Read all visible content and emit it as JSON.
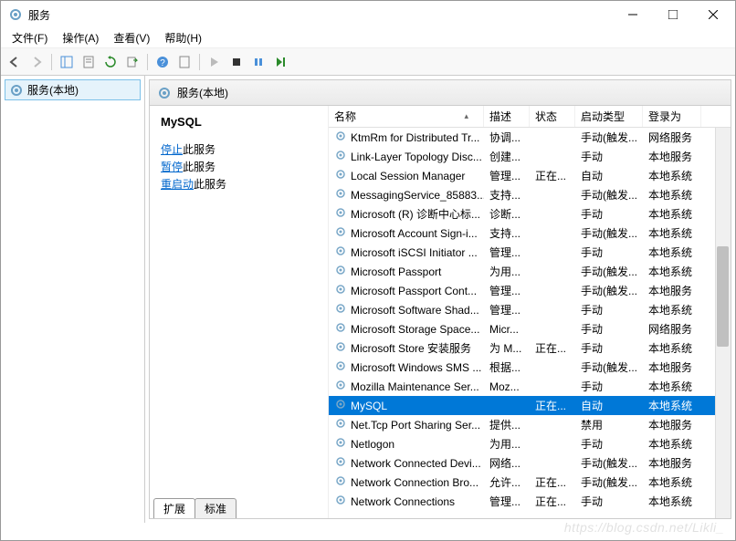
{
  "window": {
    "title": "服务",
    "tree_node": "服务(本地)",
    "right_header": "服务(本地)"
  },
  "menu": {
    "file": "文件(F)",
    "action": "操作(A)",
    "view": "查看(V)",
    "help": "帮助(H)"
  },
  "detail": {
    "service_name": "MySQL",
    "stop_link": "停止",
    "stop_suffix": "此服务",
    "pause_link": "暂停",
    "pause_suffix": "此服务",
    "restart_link": "重启动",
    "restart_suffix": "此服务"
  },
  "columns": {
    "name": "名称",
    "desc": "描述",
    "status": "状态",
    "startup": "启动类型",
    "logon": "登录为"
  },
  "tabs": {
    "extended": "扩展",
    "standard": "标准"
  },
  "watermark": "https://blog.csdn.net/Likli_",
  "services": [
    {
      "name": "KtmRm for Distributed Tr...",
      "desc": "协调...",
      "status": "",
      "startup": "手动(触发...",
      "logon": "网络服务",
      "selected": false
    },
    {
      "name": "Link-Layer Topology Disc...",
      "desc": "创建...",
      "status": "",
      "startup": "手动",
      "logon": "本地服务",
      "selected": false
    },
    {
      "name": "Local Session Manager",
      "desc": "管理...",
      "status": "正在...",
      "startup": "自动",
      "logon": "本地系统",
      "selected": false
    },
    {
      "name": "MessagingService_85883...",
      "desc": "支持...",
      "status": "",
      "startup": "手动(触发...",
      "logon": "本地系统",
      "selected": false
    },
    {
      "name": "Microsoft (R) 诊断中心标...",
      "desc": "诊断...",
      "status": "",
      "startup": "手动",
      "logon": "本地系统",
      "selected": false
    },
    {
      "name": "Microsoft Account Sign-i...",
      "desc": "支持...",
      "status": "",
      "startup": "手动(触发...",
      "logon": "本地系统",
      "selected": false
    },
    {
      "name": "Microsoft iSCSI Initiator ...",
      "desc": "管理...",
      "status": "",
      "startup": "手动",
      "logon": "本地系统",
      "selected": false
    },
    {
      "name": "Microsoft Passport",
      "desc": "为用...",
      "status": "",
      "startup": "手动(触发...",
      "logon": "本地系统",
      "selected": false
    },
    {
      "name": "Microsoft Passport Cont...",
      "desc": "管理...",
      "status": "",
      "startup": "手动(触发...",
      "logon": "本地服务",
      "selected": false
    },
    {
      "name": "Microsoft Software Shad...",
      "desc": "管理...",
      "status": "",
      "startup": "手动",
      "logon": "本地系统",
      "selected": false
    },
    {
      "name": "Microsoft Storage Space...",
      "desc": "Micr...",
      "status": "",
      "startup": "手动",
      "logon": "网络服务",
      "selected": false
    },
    {
      "name": "Microsoft Store 安装服务",
      "desc": "为 M...",
      "status": "正在...",
      "startup": "手动",
      "logon": "本地系统",
      "selected": false
    },
    {
      "name": "Microsoft Windows SMS ...",
      "desc": "根据...",
      "status": "",
      "startup": "手动(触发...",
      "logon": "本地服务",
      "selected": false
    },
    {
      "name": "Mozilla Maintenance Ser...",
      "desc": "Moz...",
      "status": "",
      "startup": "手动",
      "logon": "本地系统",
      "selected": false
    },
    {
      "name": "MySQL",
      "desc": "",
      "status": "正在...",
      "startup": "自动",
      "logon": "本地系统",
      "selected": true
    },
    {
      "name": "Net.Tcp Port Sharing Ser...",
      "desc": "提供...",
      "status": "",
      "startup": "禁用",
      "logon": "本地服务",
      "selected": false
    },
    {
      "name": "Netlogon",
      "desc": "为用...",
      "status": "",
      "startup": "手动",
      "logon": "本地系统",
      "selected": false
    },
    {
      "name": "Network Connected Devi...",
      "desc": "网络...",
      "status": "",
      "startup": "手动(触发...",
      "logon": "本地服务",
      "selected": false
    },
    {
      "name": "Network Connection Bro...",
      "desc": "允许...",
      "status": "正在...",
      "startup": "手动(触发...",
      "logon": "本地系统",
      "selected": false
    },
    {
      "name": "Network Connections",
      "desc": "管理...",
      "status": "正在...",
      "startup": "手动",
      "logon": "本地系统",
      "selected": false
    }
  ]
}
